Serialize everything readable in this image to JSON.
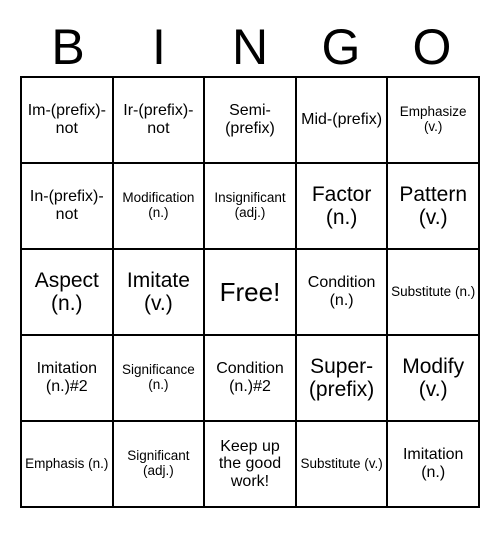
{
  "header": [
    "B",
    "I",
    "N",
    "G",
    "O"
  ],
  "grid": [
    [
      {
        "text": "Im-(prefix)-not",
        "size": "medium"
      },
      {
        "text": "Ir-(prefix)-not",
        "size": "medium"
      },
      {
        "text": "Semi-(prefix)",
        "size": "medium"
      },
      {
        "text": "Mid-(prefix)",
        "size": "medium"
      },
      {
        "text": "Emphasize (v.)",
        "size": "small"
      }
    ],
    [
      {
        "text": "In-(prefix)-not",
        "size": "medium"
      },
      {
        "text": "Modification (n.)",
        "size": "small"
      },
      {
        "text": "Insignificant (adj.)",
        "size": "small"
      },
      {
        "text": "Factor (n.)",
        "size": "large"
      },
      {
        "text": "Pattern (v.)",
        "size": "large"
      }
    ],
    [
      {
        "text": "Aspect (n.)",
        "size": "large"
      },
      {
        "text": "Imitate (v.)",
        "size": "large"
      },
      {
        "text": "Free!",
        "size": "free"
      },
      {
        "text": "Condition (n.)",
        "size": "medium"
      },
      {
        "text": "Substitute (n.)",
        "size": "small"
      }
    ],
    [
      {
        "text": "Imitation (n.)#2",
        "size": "medium"
      },
      {
        "text": "Significance (n.)",
        "size": "small"
      },
      {
        "text": "Condition (n.)#2",
        "size": "medium"
      },
      {
        "text": "Super-(prefix)",
        "size": "large"
      },
      {
        "text": "Modify (v.)",
        "size": "large"
      }
    ],
    [
      {
        "text": "Emphasis (n.)",
        "size": "small"
      },
      {
        "text": "Significant (adj.)",
        "size": "small"
      },
      {
        "text": "Keep up the good work!",
        "size": "medium"
      },
      {
        "text": "Substitute (v.)",
        "size": "small"
      },
      {
        "text": "Imitation (n.)",
        "size": "medium"
      }
    ]
  ]
}
